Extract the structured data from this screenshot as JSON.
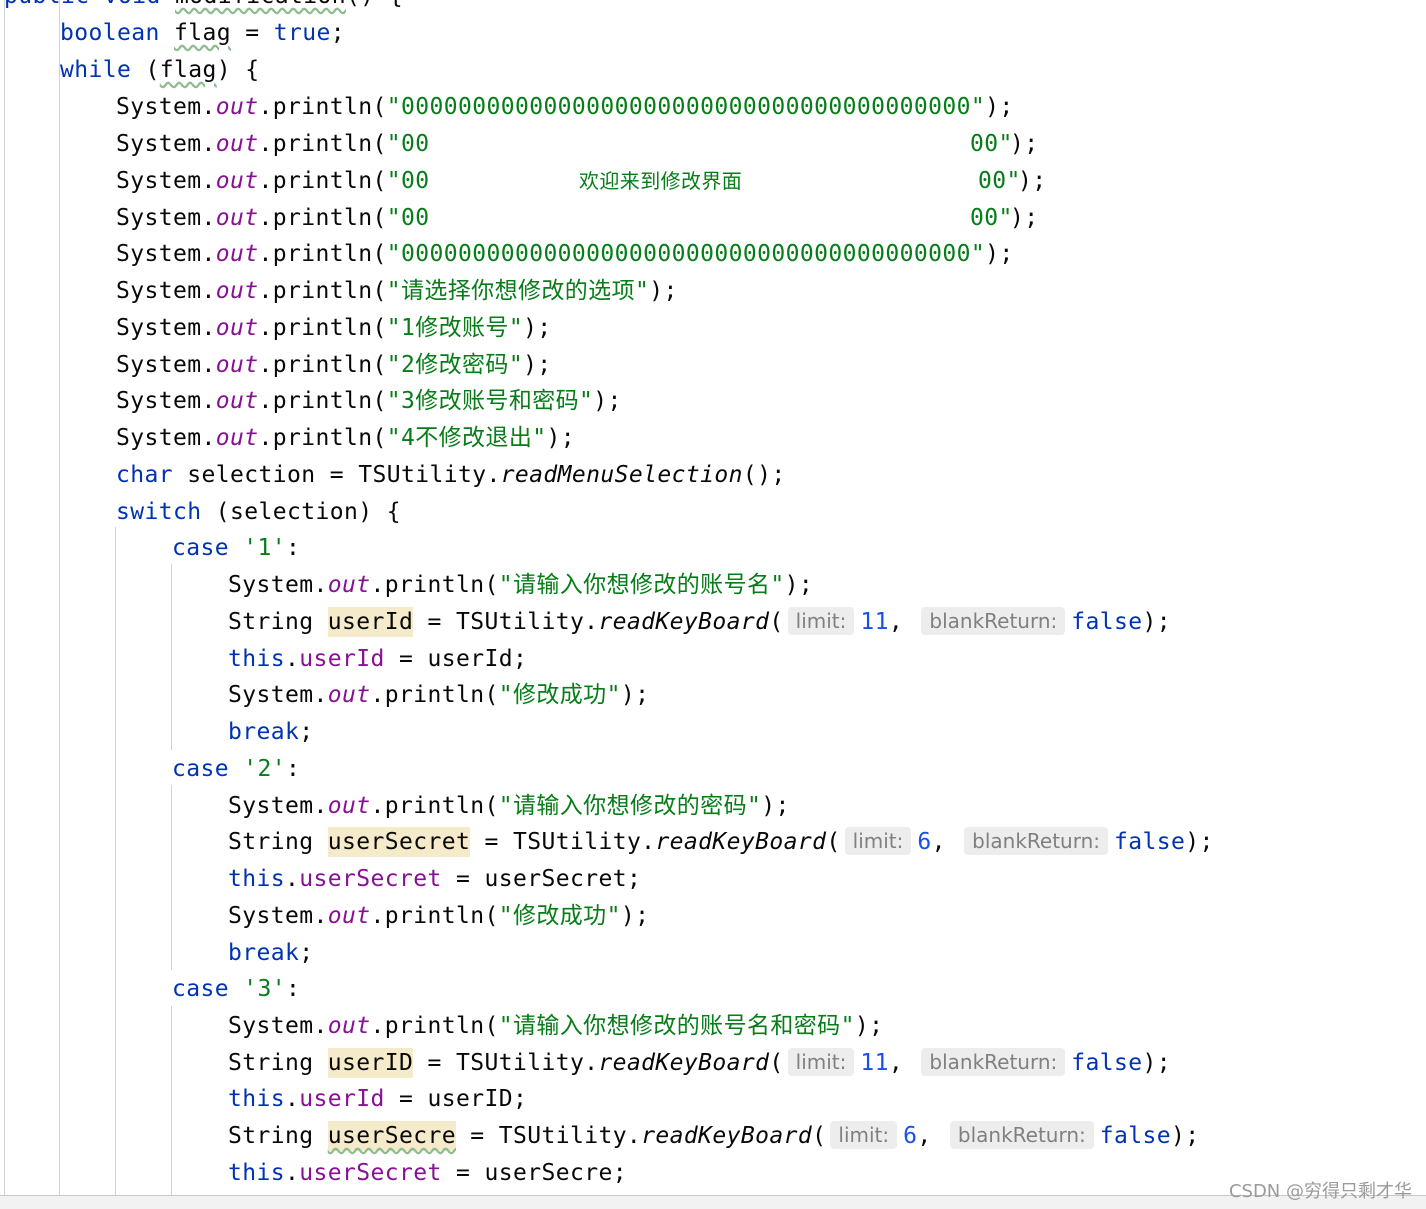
{
  "editor": {
    "line0": {
      "kw1": "public",
      "kw2": "void",
      "method": "modification",
      "rest": "() {"
    },
    "line1": {
      "kw": "boolean",
      "var": "flag",
      "op": " = ",
      "val": "true",
      "end": ";"
    },
    "line2": {
      "kw": "while",
      "open": " (",
      "var": "flag",
      "close": ") {"
    },
    "println": {
      "cls": "System.",
      "out": "out",
      ".m": ".println(",
      "end": ");"
    },
    "banner": {
      "top": "\"0000000000000000000000000000000000000000\"",
      "mid_left": "\"00",
      "mid_right": "00\"",
      "welcome": "欢迎来到修改界面",
      "welcome_right": "00\"",
      "bottom": "\"0000000000000000000000000000000000000000\""
    },
    "menu": {
      "prompt": "\"请选择你想修改的选项\"",
      "opt1": "\"1修改账号\"",
      "opt2": "\"2修改密码\"",
      "opt3": "\"3修改账号和密码\"",
      "opt4": "\"4不修改退出\""
    },
    "sel_line": {
      "kw": "char",
      "mid": " selection = TSUtility.",
      "call": "readMenuSelection",
      "end": "();"
    },
    "switch_line": {
      "kw": "switch",
      "rest": " (selection) {"
    },
    "case_kw": "case",
    "cases": {
      "c1": "'1'",
      "c2": "'2'",
      "c3": "'3'",
      "colon": ":"
    },
    "case1": {
      "msg": "\"请输入你想修改的账号名\"",
      "type": "String",
      "var": "userId",
      "read": " = TSUtility.",
      "call": "readKeyBoard",
      "paren": "(",
      "hint1": "limit:",
      "n1": "11",
      "comma": ",",
      "hint2": "blankReturn:",
      "b": "false",
      "close": ");",
      "this": "this",
      "dot": ".",
      "field": "userId",
      "assign": " = userId;",
      "ok": "\"修改成功\"",
      "brk": "break",
      "semi": ";"
    },
    "case2": {
      "msg": "\"请输入你想修改的密码\"",
      "var": "userSecret",
      "n1": "6",
      "field": "userSecret",
      "assign": " = userSecret;"
    },
    "case3": {
      "msg": "\"请输入你想修改的账号名和密码\"",
      "var1": "userID",
      "n1": "11",
      "field1": "userId",
      "assign1": " = userID;",
      "var2": "userSecre",
      "n2": "6",
      "field2": "userSecret",
      "assign2": " = userSecre;"
    }
  },
  "watermark": "CSDN @穷得只剩才华"
}
